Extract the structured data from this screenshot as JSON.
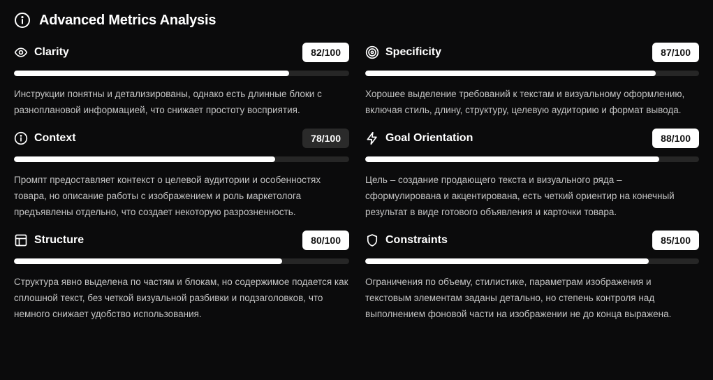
{
  "header": {
    "title": "Advanced Metrics Analysis",
    "icon": "info-circle-icon"
  },
  "metrics": [
    {
      "id": "clarity",
      "label": "Clarity",
      "icon": "eye-icon",
      "score_text": "82/100",
      "score": 82,
      "badge_style": "light",
      "description": "Инструкции понятны и детализированы, однако есть длинные блоки с разноплановой информацией, что снижает простоту восприятия."
    },
    {
      "id": "specificity",
      "label": "Specificity",
      "icon": "target-icon",
      "score_text": "87/100",
      "score": 87,
      "badge_style": "light",
      "description": "Хорошее выделение требований к текстам и визуальному оформлению, включая стиль, длину, структуру, целевую аудиторию и формат вывода."
    },
    {
      "id": "context",
      "label": "Context",
      "icon": "info-circle-icon",
      "score_text": "78/100",
      "score": 78,
      "badge_style": "dark",
      "description": "Промпт предоставляет контекст о целевой аудитории и особенностях товара, но описание работы с изображением и роль маркетолога предъявлены отдельно, что создает некоторую разрозненность."
    },
    {
      "id": "goal-orientation",
      "label": "Goal Orientation",
      "icon": "lightning-icon",
      "score_text": "88/100",
      "score": 88,
      "badge_style": "light",
      "description": "Цель – создание продающего текста и визуального ряда – сформулирована и акцентирована, есть четкий ориентир на конечный результат в виде готового объявления и карточки товара."
    },
    {
      "id": "structure",
      "label": "Structure",
      "icon": "layout-icon",
      "score_text": "80/100",
      "score": 80,
      "badge_style": "light",
      "description": "Структура явно выделена по частям и блокам, но содержимое подается как сплошной текст, без четкой визуальной разбивки и подзаголовков, что немного снижает удобство использования."
    },
    {
      "id": "constraints",
      "label": "Constraints",
      "icon": "shield-icon",
      "score_text": "85/100",
      "score": 85,
      "badge_style": "light",
      "description": "Ограничения по объему, стилистике, параметрам изображения и текстовым элементам заданы детально, но степень контроля над выполнением фоновой части на изображении не до конца выражена."
    }
  ]
}
